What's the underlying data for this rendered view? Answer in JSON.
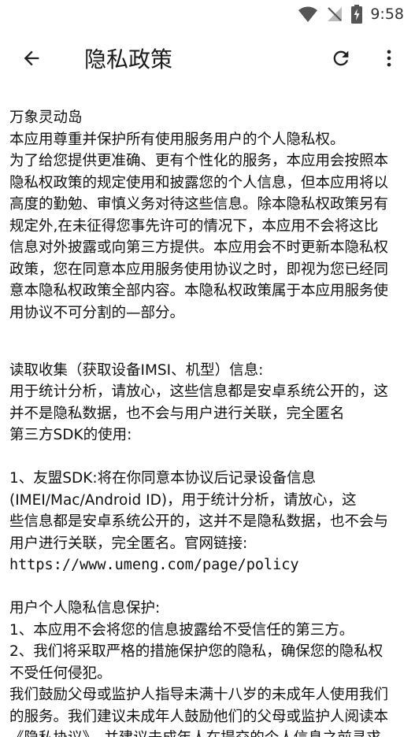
{
  "status_bar": {
    "time": "9:58",
    "icons": [
      "wifi-icon",
      "no-signal-icon",
      "battery-charging-icon"
    ]
  },
  "app_bar": {
    "title": "隐私政策",
    "back_icon": "arrow-back-icon",
    "refresh_icon": "refresh-icon",
    "more_icon": "more-vert-icon"
  },
  "content": {
    "app_name": "万象灵动岛",
    "intro_lines": [
      "本应用尊重并保护所有使用服务用户的个人隐私权。",
      "为了给您提供更准确、更有个性化的服务，本应用会按照本",
      "隐私权政策的规定使用和披露您的个人信息，但本应用将以",
      "高度的勤勉、审慎义务对待这些信息。除本隐私权政策另有",
      "规定外,在未征得您事先许可的情况下，本应用不会将这比",
      "信息对外披露或向第三方提供。本应用会不时更新本隐私权",
      "政策，您在同意本应用服务使用协议之时，即视为您已经同",
      "意本隐私权政策全部内容。本隐私权政策属于本应用服务使",
      "用协议不可分割的—部分。"
    ],
    "collect_lines": [
      "读取收集（获取设备IMSI、机型）信息:",
      "用于统计分析，请放心，这些信息都是安卓系统公开的，这",
      "并不是隐私数据，也不会与用户进行关联，完全匿名",
      "第三方SDK的使用:"
    ],
    "sdk_lines": [
      "1、友盟SDK:将在你同意本协议后记录设备信息",
      "(IMEI/Mac/Android ID)，用于统计分析，请放心，这",
      "些信息都是安卓系统公开的，这并不是隐私数据，也不会与",
      "用户进行关联，完全匿名。官网链接:"
    ],
    "sdk_link": "https://www.umeng.com/page/policy",
    "protect_lines": [
      "用户个人隐私信息保护:",
      "1、本应用不会将您的信息披露给不受信任的第三方。",
      "2、我们将采取严格的措施保护您的隐私，确保您的隐私权",
      "不受任何侵犯。",
      "我们鼓励父母或监护人指导未满十八岁的未成年人使用我们",
      "的服务。我们建议未成年人鼓励他们的父母或监护人阅读本",
      "《隐私协议》，并建议未成年人在提交的个人信息之前寻求"
    ]
  }
}
